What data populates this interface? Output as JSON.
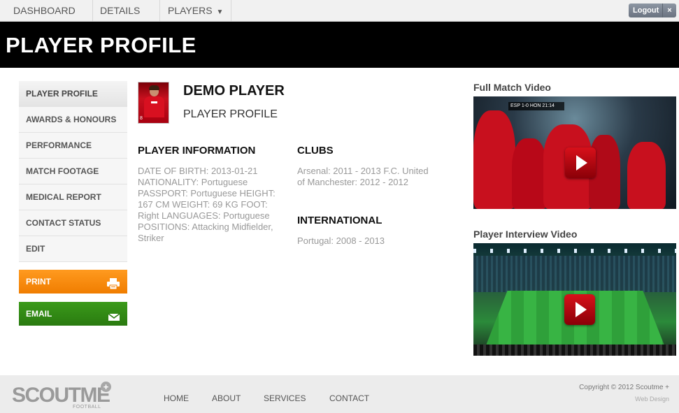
{
  "nav": {
    "items": [
      {
        "label": "DASHBOARD"
      },
      {
        "label": "DETAILS"
      },
      {
        "label": "PLAYERS"
      }
    ],
    "logout_label": "Logout",
    "logout_close": "×"
  },
  "header": {
    "title": "PLAYER PROFILE"
  },
  "sidebar": {
    "items": [
      {
        "label": "PLAYER PROFILE",
        "active": true
      },
      {
        "label": "AWARDS & HONOURS"
      },
      {
        "label": "PERFORMANCE"
      },
      {
        "label": "MATCH FOOTAGE"
      },
      {
        "label": "MEDICAL REPORT"
      },
      {
        "label": "CONTACT STATUS"
      },
      {
        "label": "EDIT"
      }
    ],
    "print_label": "PRINT",
    "email_label": "EMAIL",
    "print_icon": "printer-icon",
    "email_icon": "envelope-icon",
    "print_color": "#f68a0a",
    "email_color": "#32891a"
  },
  "player": {
    "name": "DEMO PLAYER",
    "subtitle": "PLAYER PROFILE",
    "shirt_number": "8"
  },
  "info": {
    "heading": "PLAYER INFORMATION",
    "text": "DATE OF BIRTH: 2013-01-21 NATIONALITY: Portuguese PASSPORT: Portuguese HEIGHT: 167 CM WEIGHT: 69 KG FOOT: Right LANGUAGES: Portuguese POSITIONS: Attacking Midfielder, Striker"
  },
  "clubs": {
    "heading": "CLUBS",
    "text": "Arsenal: 2011 - 2013 F.C. United of Manchester: 2012 - 2012"
  },
  "international": {
    "heading": "INTERNATIONAL",
    "text": "Portugal: 2008 - 2013"
  },
  "videos": {
    "full_match": {
      "title": "Full Match Video",
      "scoreboard": "ESP 1-0 HON 21:14"
    },
    "interview": {
      "title": "Player Interview Video"
    }
  },
  "footer": {
    "logo": "SCOUTME",
    "logo_plus": "+",
    "logo_sub": "FOOTBALL",
    "links": [
      {
        "label": "HOME"
      },
      {
        "label": "ABOUT"
      },
      {
        "label": "SERVICES"
      },
      {
        "label": "CONTACT"
      }
    ],
    "copyright": "Copyright © 2012 Scoutme +",
    "credit": "Web Design"
  }
}
